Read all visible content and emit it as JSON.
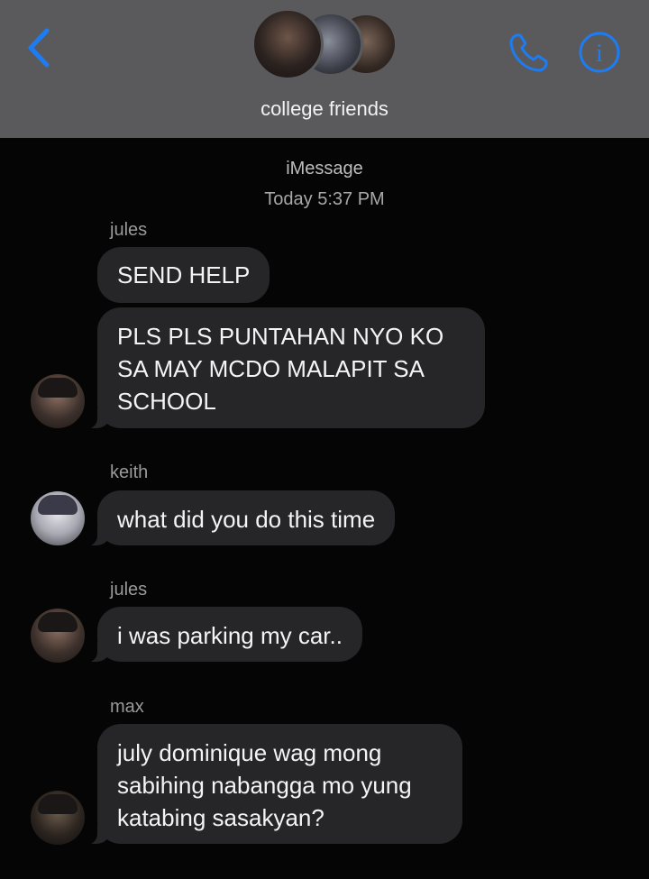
{
  "header": {
    "back_icon": "chevron-left-icon",
    "group_name": "college friends",
    "phone_icon": "phone-icon",
    "info_icon": "info-icon",
    "accent": "#1e7cf2"
  },
  "conversation": {
    "service": "iMessage",
    "timestamp": "Today 5:37 PM",
    "messages": [
      {
        "sender": "jules",
        "text": "SEND HELP"
      },
      {
        "sender": "",
        "text": "PLS PLS PUNTAHAN NYO KO\nSA MAY MCDO MALAPIT SA\nSCHOOL"
      },
      {
        "sender": "keith",
        "text": "what did you do this time"
      },
      {
        "sender": "jules",
        "text": "i was parking my car.."
      },
      {
        "sender": "max",
        "text": "july dominique wag mong\nsabihing nabangga mo yung\nkatabing sasakyan?"
      }
    ]
  }
}
